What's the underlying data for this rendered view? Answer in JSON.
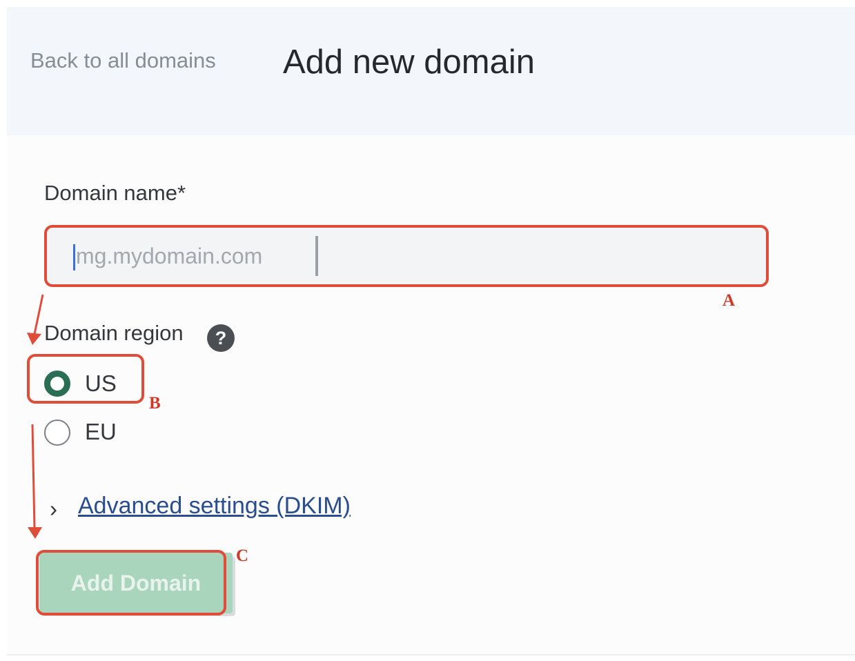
{
  "header": {
    "back_link": "Back to all domains",
    "title": "Add new domain"
  },
  "form": {
    "domain_label": "Domain name*",
    "domain_placeholder": "mg.mydomain.com",
    "domain_value": "",
    "region_label": "Domain region",
    "help_icon_glyph": "?",
    "regions": [
      {
        "label": "US",
        "selected": true
      },
      {
        "label": "EU",
        "selected": false
      }
    ],
    "advanced_chevron": "›",
    "advanced_link": "Advanced settings (DKIM)",
    "submit_label": "Add Domain",
    "submit_disabled": true
  },
  "annotations": {
    "a": "A",
    "b": "B",
    "c": "C"
  },
  "colors": {
    "accent": "#2a6e54",
    "button_disabled": "#a9d5bd",
    "link": "#2a4d8f",
    "annotation": "#df4d3a",
    "header_bg": "#f3f6fa"
  }
}
